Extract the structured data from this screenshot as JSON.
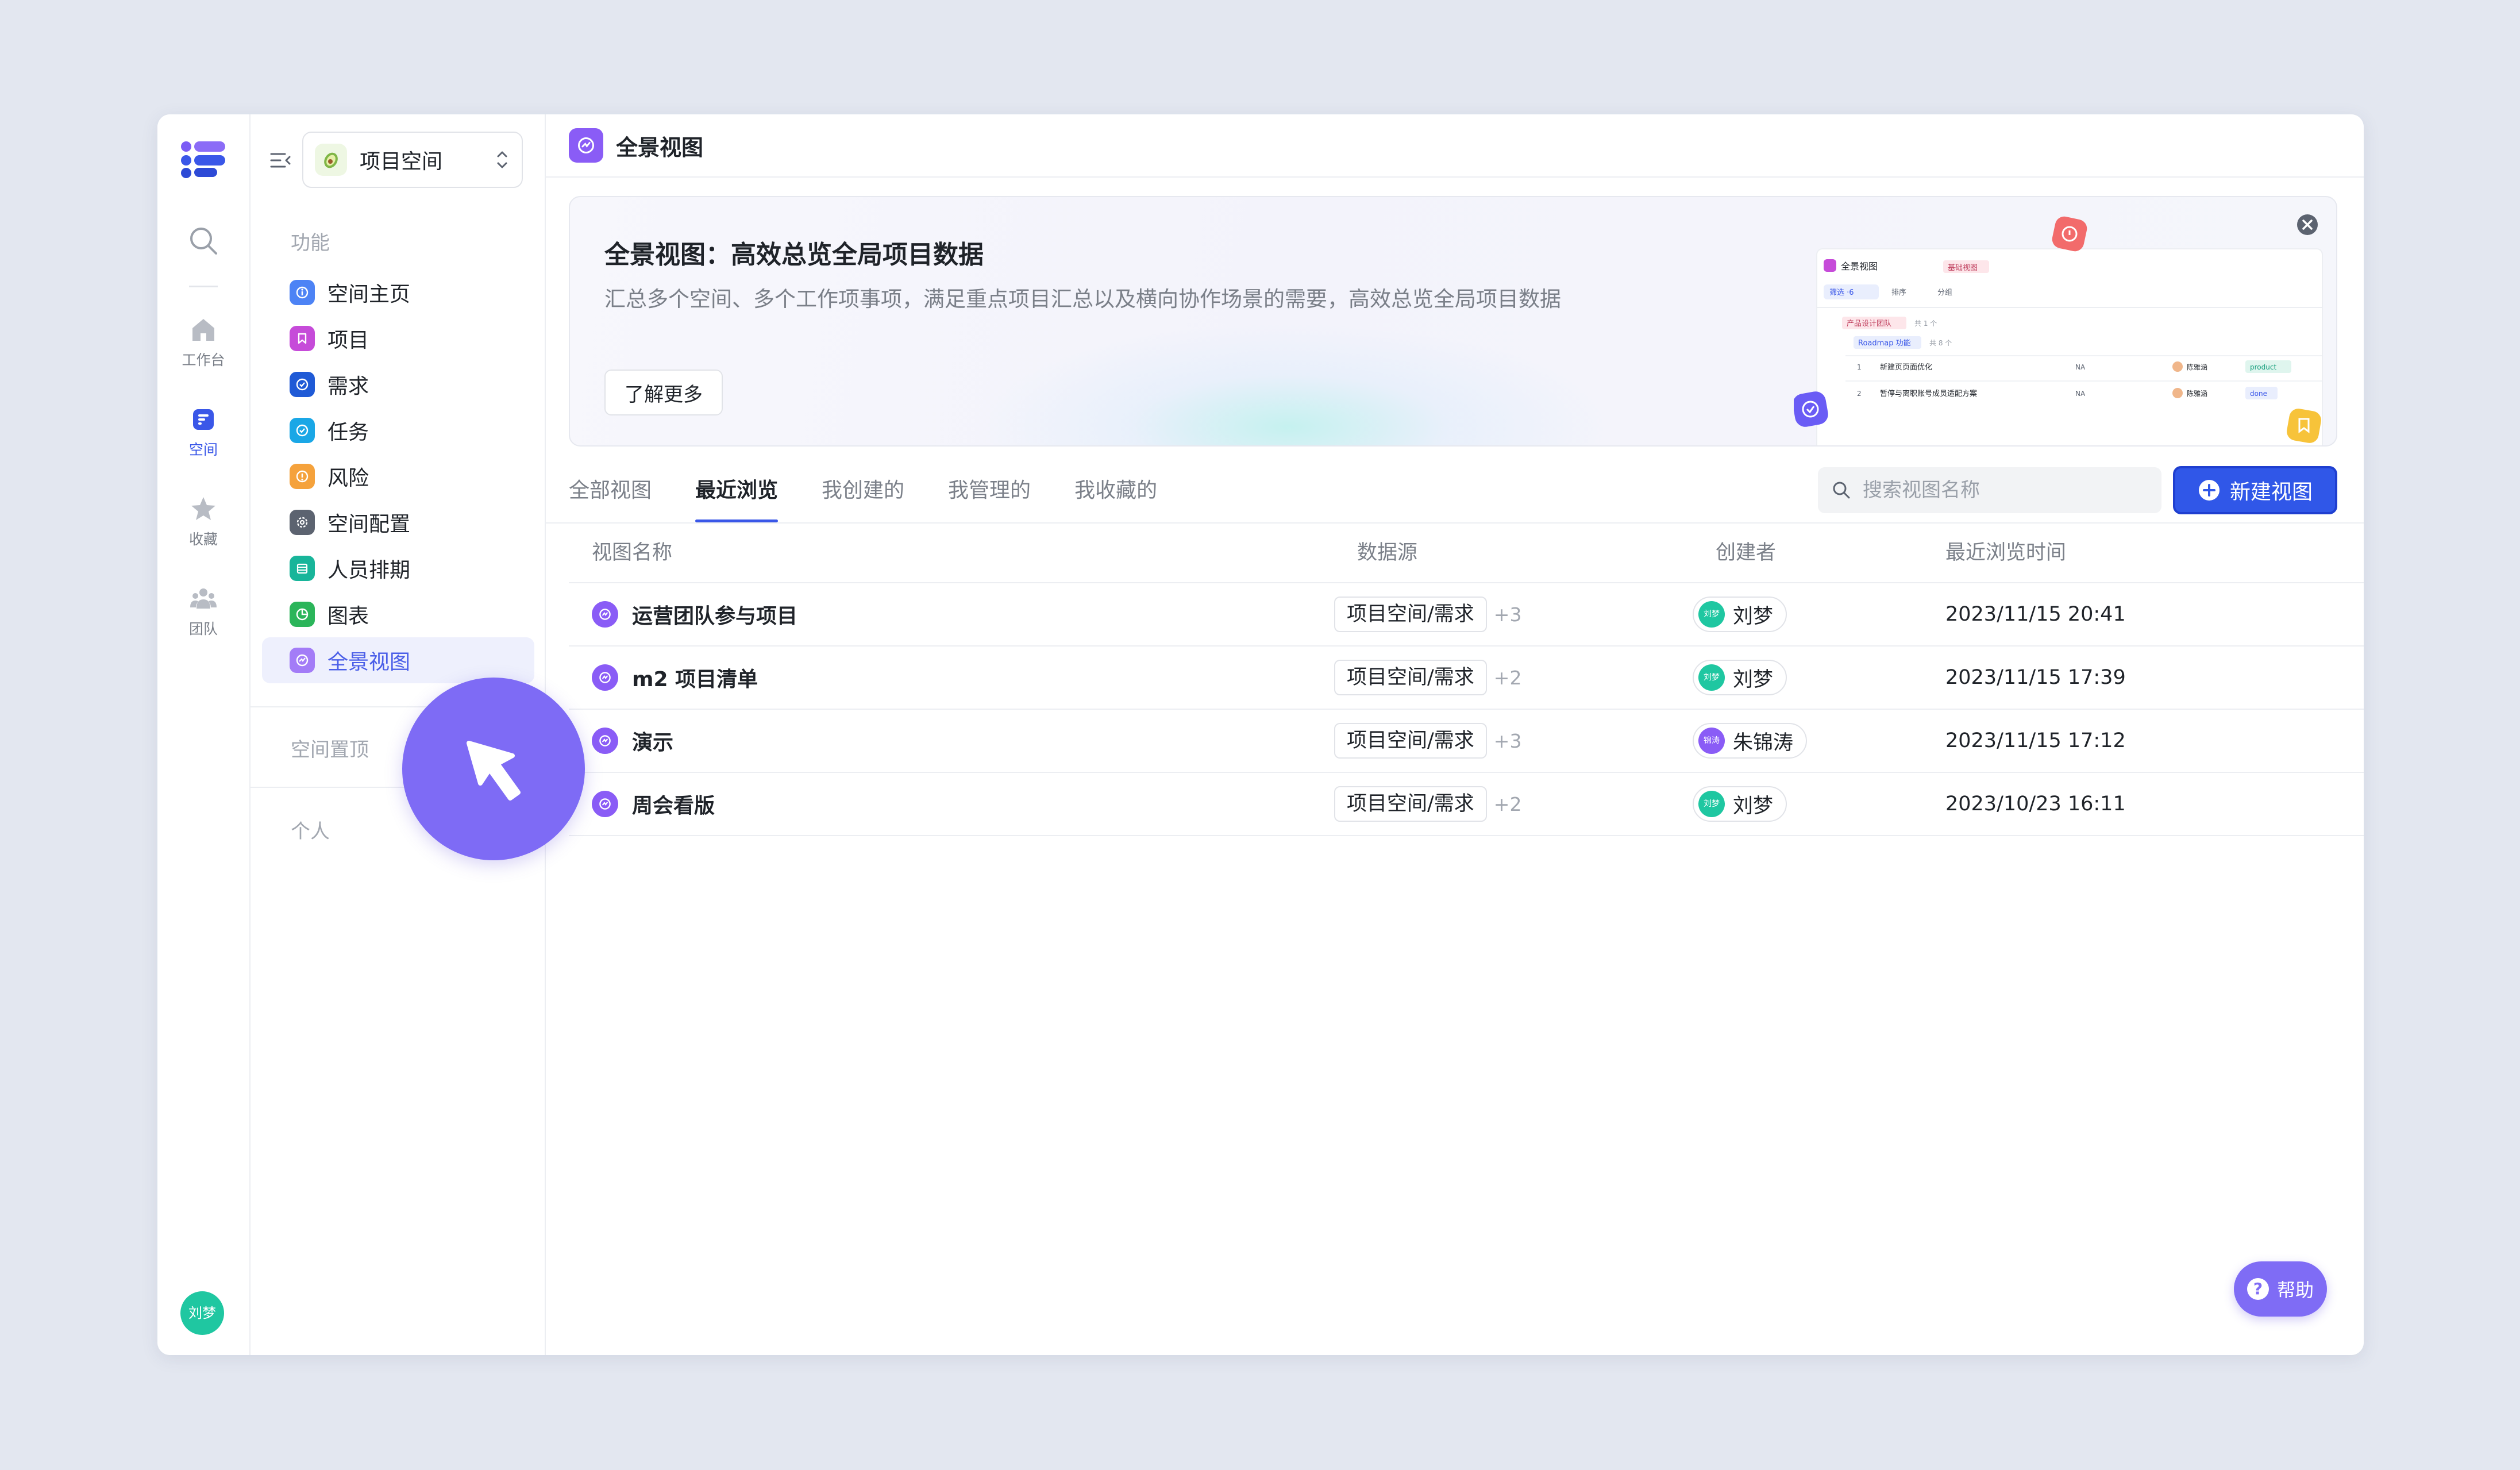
{
  "rail": {
    "items": [
      {
        "label": "工作台"
      },
      {
        "label": "空间"
      },
      {
        "label": "收藏"
      },
      {
        "label": "团队"
      }
    ],
    "avatar": "刘梦"
  },
  "sidebar": {
    "space_name": "项目空间",
    "section_features": "功能",
    "items": [
      {
        "label": "空间主页",
        "color": "#4d83f5"
      },
      {
        "label": "项目",
        "color": "#c64bd9"
      },
      {
        "label": "需求",
        "color": "#1f5ad6"
      },
      {
        "label": "任务",
        "color": "#1aa7e6"
      },
      {
        "label": "风险",
        "color": "#f5a23c"
      },
      {
        "label": "空间配置",
        "color": "#5c6370"
      },
      {
        "label": "人员排期",
        "color": "#18b59a"
      },
      {
        "label": "图表",
        "color": "#2bb55a"
      },
      {
        "label": "全景视图",
        "color": "#a37cf7"
      }
    ],
    "section_pinned": "空间置顶",
    "section_personal": "个人"
  },
  "header": {
    "title": "全景视图"
  },
  "banner": {
    "title": "全景视图：高效总览全局项目数据",
    "description": "汇总多个空间、多个工作项事项，满足重点项目汇总以及横向协作场景的需要，高效总览全局项目数据",
    "button": "了解更多"
  },
  "tabs": [
    {
      "label": "全部视图"
    },
    {
      "label": "最近浏览",
      "active": true
    },
    {
      "label": "我创建的"
    },
    {
      "label": "我管理的"
    },
    {
      "label": "我收藏的"
    }
  ],
  "search": {
    "placeholder": "搜索视图名称"
  },
  "new_view_button": "新建视图",
  "table": {
    "columns": [
      "视图名称",
      "数据源",
      "创建者",
      "最近浏览时间"
    ],
    "rows": [
      {
        "name": "运营团队参与项目",
        "source": "项目空间/需求",
        "more": "+3",
        "creator": "刘梦",
        "avatar_text": "刘梦",
        "avatar_color": "#1fc7a1",
        "time": "2023/11/15 20:41"
      },
      {
        "name": "m2 项目清单",
        "source": "项目空间/需求",
        "more": "+2",
        "creator": "刘梦",
        "avatar_text": "刘梦",
        "avatar_color": "#1fc7a1",
        "time": "2023/11/15 17:39"
      },
      {
        "name": "演示",
        "source": "项目空间/需求",
        "more": "+3",
        "creator": "朱锦涛",
        "avatar_text": "锦涛",
        "avatar_color": "#8a5cf6",
        "time": "2023/11/15 17:12"
      },
      {
        "name": "周会看版",
        "source": "项目空间/需求",
        "more": "+2",
        "creator": "刘梦",
        "avatar_text": "刘梦",
        "avatar_color": "#1fc7a1",
        "time": "2023/10/23 16:11"
      }
    ]
  },
  "preview": {
    "title": "全景视图",
    "tag": "基础视图",
    "filter": "筛选 ·6",
    "sort": "排序",
    "group": "分组",
    "group1": "产品设计团队",
    "group1_count": "共 1 个",
    "group2": "Roadmap 功能",
    "group2_count": "共 8 个",
    "rows": [
      {
        "no": "1",
        "title": "新建页页面优化",
        "val": "NA",
        "owner": "陈雅涵",
        "tag": "product"
      },
      {
        "no": "2",
        "title": "暂停与离职账号成员适配方案",
        "val": "NA",
        "owner": "陈雅涵",
        "tag": "done"
      }
    ]
  },
  "help": "帮助"
}
